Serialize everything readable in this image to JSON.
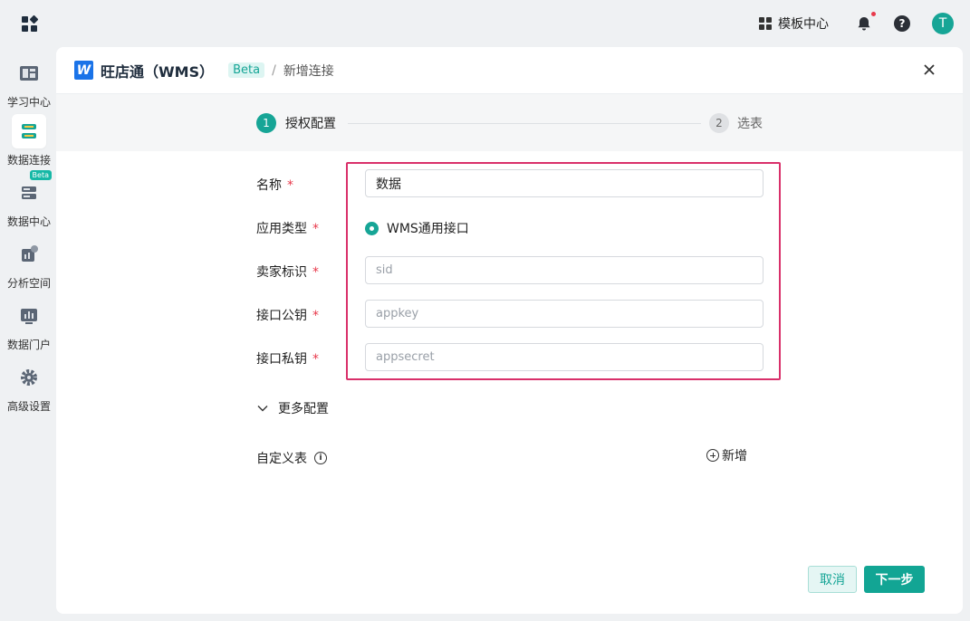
{
  "topbar": {
    "template_center": "模板中心",
    "avatar_letter": "T"
  },
  "sidebar": {
    "items": [
      {
        "label": "学习中心",
        "icon": "book-icon"
      },
      {
        "label": "数据连接",
        "icon": "database-connection-icon"
      },
      {
        "label": "数据中心",
        "icon": "server-icon",
        "badge": "Beta"
      },
      {
        "label": "分析空间",
        "icon": "analysis-icon"
      },
      {
        "label": "数据门户",
        "icon": "portal-icon"
      },
      {
        "label": "高级设置",
        "icon": "gear-icon"
      }
    ]
  },
  "panel": {
    "brand_letter": "W",
    "title": "旺店通（WMS）",
    "beta": "Beta",
    "separator": "/",
    "crumb": "新增连接"
  },
  "steps": [
    {
      "number": "1",
      "label": "授权配置"
    },
    {
      "number": "2",
      "label": "选表"
    }
  ],
  "form": {
    "required_mark": "*",
    "name": {
      "label": "名称",
      "value": "数据"
    },
    "app_type": {
      "label": "应用类型",
      "option": "WMS通用接口"
    },
    "seller_id": {
      "label": "卖家标识",
      "placeholder": "sid"
    },
    "app_key": {
      "label": "接口公钥",
      "placeholder": "appkey"
    },
    "app_secret": {
      "label": "接口私钥",
      "placeholder": "appsecret"
    }
  },
  "more_config": "更多配置",
  "custom_table": {
    "label": "自定义表",
    "info": "i",
    "add": "新增"
  },
  "buttons": {
    "cancel": "取消",
    "next": "下一步"
  },
  "colors": {
    "primary": "#16a596",
    "highlight": "#d9306a",
    "required": "#e83a4c"
  }
}
